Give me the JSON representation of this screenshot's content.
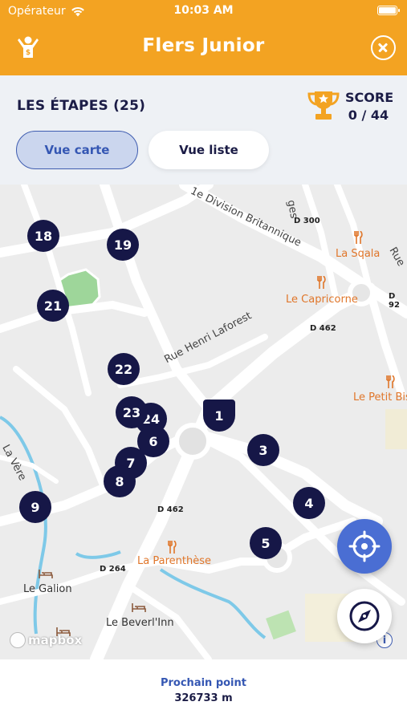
{
  "status_bar": {
    "carrier": "Opérateur",
    "time": "10:03 AM"
  },
  "app": {
    "title": "Flers Junior"
  },
  "header": {
    "steps_title": "LES ÉTAPES (25)",
    "score_label": "SCORE",
    "score_value": "0 / 44",
    "tab_map_label": "Vue carte",
    "tab_list_label": "Vue liste",
    "active_tab": "Vue carte"
  },
  "map": {
    "street_labels": [
      "1e Division Britannique",
      "Rue Henri Laforest",
      "La Vère",
      "ges",
      "Rue"
    ],
    "road_labels": [
      "D 300",
      "D 462",
      "D 462",
      "D 264",
      "D 92"
    ],
    "pois": [
      "La Sqala",
      "Le Capricorne",
      "Le Petit Bis",
      "La Parenthèse"
    ],
    "places": [
      "Le Galion",
      "Le Bevert'Inn",
      "Le Beverl'Inn"
    ],
    "attribution": "mapbox",
    "markers": [
      {
        "label": "18"
      },
      {
        "label": "19"
      },
      {
        "label": "21"
      },
      {
        "label": "22"
      },
      {
        "label": "23"
      },
      {
        "label": "24"
      },
      {
        "label": "1"
      },
      {
        "label": "6"
      },
      {
        "label": "7"
      },
      {
        "label": "8"
      },
      {
        "label": "3"
      },
      {
        "label": "4"
      },
      {
        "label": "5"
      },
      {
        "label": "9"
      }
    ],
    "colors": {
      "marker": "#161747",
      "poi": "#e0762a",
      "accent": "#f3a322",
      "button": "#4a6ed3"
    }
  },
  "footer": {
    "next_label": "Prochain point",
    "next_distance": "326733 m"
  }
}
